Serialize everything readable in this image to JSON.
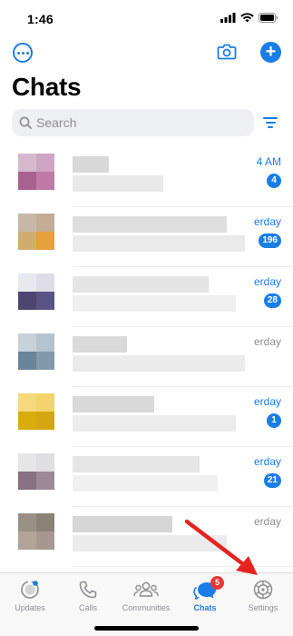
{
  "status": {
    "time": "1:46"
  },
  "header": {
    "title": "Chats"
  },
  "search": {
    "placeholder": "Search"
  },
  "chats": [
    {
      "time": "4 AM",
      "unread": "4",
      "time_color": "blue",
      "avatar": [
        "#d6b9cf",
        "#cfa4c4",
        "#a9628f",
        "#c07aa7"
      ],
      "lines": [
        [
          "#d8d8d8",
          40
        ],
        [
          "#e8e8e8",
          100
        ]
      ]
    },
    {
      "time": "erday",
      "unread": "196",
      "time_color": "blue",
      "avatar": [
        "#c7b7a7",
        "#c4ad95",
        "#d0ad6e",
        "#e6a03c"
      ],
      "lines": [
        [
          "#dedede",
          170
        ],
        [
          "#eaeaea",
          190
        ]
      ]
    },
    {
      "time": "erday",
      "unread": "28",
      "time_color": "blue",
      "avatar": [
        "#e8e8ef",
        "#dedce6",
        "#4e4670",
        "#5a5385"
      ],
      "lines": [
        [
          "#e4e4e4",
          150
        ],
        [
          "#efefef",
          180
        ]
      ]
    },
    {
      "time": "erday",
      "unread": "",
      "time_color": "gray",
      "avatar": [
        "#c8d0da",
        "#b7c2cf",
        "#6a8499",
        "#8299ac"
      ],
      "lines": [
        [
          "#d9d9d9",
          60
        ],
        [
          "#ebebeb",
          190
        ]
      ]
    },
    {
      "time": "erday",
      "unread": "1",
      "time_color": "blue",
      "avatar": [
        "#f5d97a",
        "#f3d36c",
        "#d9ad0c",
        "#d4a712"
      ],
      "lines": [
        [
          "#d9d9d9",
          90
        ],
        [
          "#ececec",
          180
        ]
      ]
    },
    {
      "time": "erday",
      "unread": "21",
      "time_color": "blue",
      "avatar": [
        "#e6e6e9",
        "#dedee3",
        "#8a7080",
        "#9d8996"
      ],
      "lines": [
        [
          "#e6e6e6",
          140
        ],
        [
          "#f0f0f0",
          160
        ]
      ]
    },
    {
      "time": "erday",
      "unread": "",
      "time_color": "gray",
      "avatar": [
        "#9a8f85",
        "#8a8277",
        "#b3a49a",
        "#a69890"
      ],
      "lines": [
        [
          "#d6d6d6",
          110
        ],
        [
          "#ebebeb",
          170
        ]
      ]
    }
  ],
  "tabs": [
    {
      "label": "Updates",
      "icon": "updates-icon"
    },
    {
      "label": "Calls",
      "icon": "phone-icon"
    },
    {
      "label": "Communities",
      "icon": "communities-icon"
    },
    {
      "label": "Chats",
      "icon": "chats-icon",
      "badge": "5"
    },
    {
      "label": "Settings",
      "icon": "gear-icon"
    }
  ],
  "colors": {
    "accent": "#1a7de8",
    "badge": "#e53935",
    "arrow": "#e52420"
  }
}
